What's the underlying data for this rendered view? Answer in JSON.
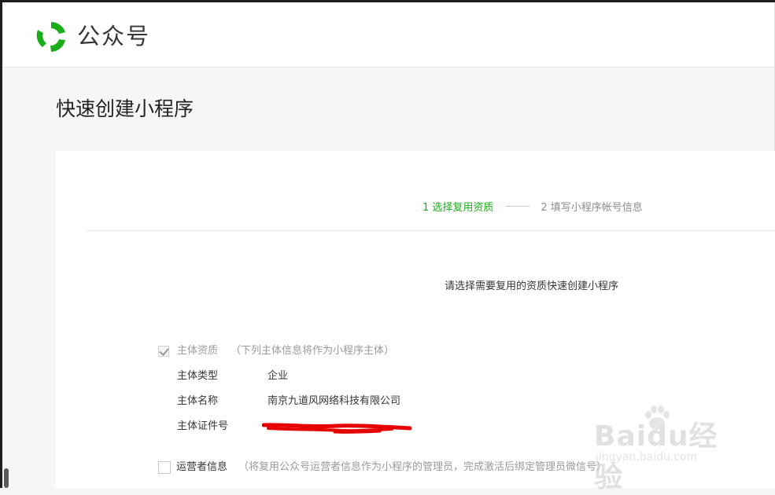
{
  "header": {
    "brand_name": "公众号",
    "logo_icon": "wechat-mp-logo-icon",
    "brand_color": "#1aad19"
  },
  "page": {
    "title": "快速创建小程序"
  },
  "steps": [
    {
      "label": "1 选择复用资质",
      "active": true
    },
    {
      "label": "2 填写小程序帐号信息",
      "active": false
    }
  ],
  "prompt": "请选择需要复用的资质快速创建小程序",
  "qualification": {
    "checked": true,
    "label": "主体资质",
    "hint": "（下列主体信息将作为小程序主体）",
    "rows": [
      {
        "key": "主体类型",
        "value": "企业"
      },
      {
        "key": "主体名称",
        "value": "南京九道风网络科技有限公司"
      },
      {
        "key": "主体证件号",
        "value": ""
      }
    ]
  },
  "operator": {
    "checked": false,
    "label": "运营者信息",
    "hint": "（将复用公众号运营者信息作为小程序的管理员，完成激活后绑定管理员微信号）"
  },
  "watermark": {
    "text": "Baidu经验",
    "url": "jingyan.baidu.com"
  }
}
